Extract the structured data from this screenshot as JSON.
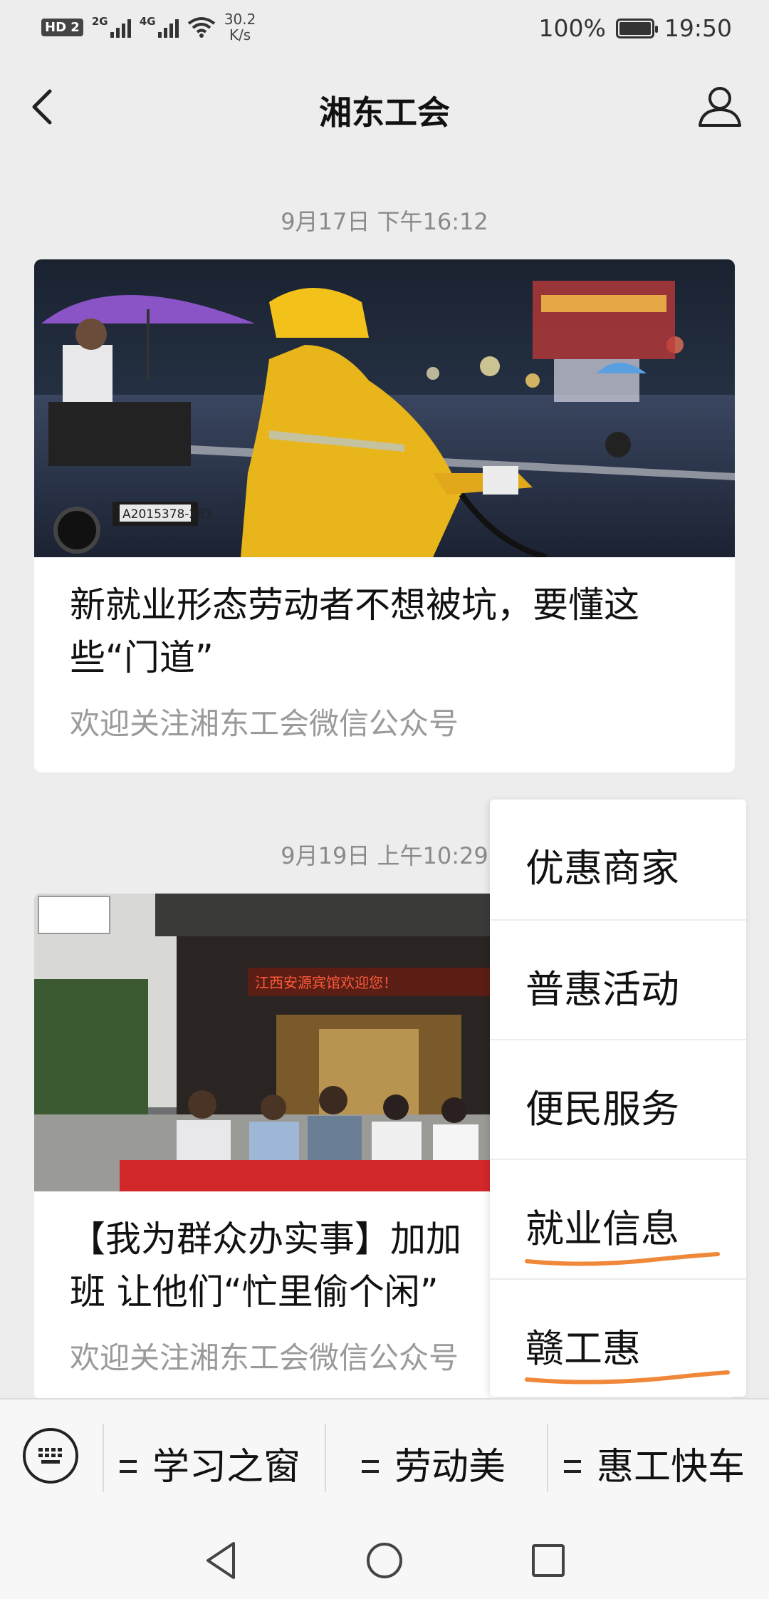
{
  "status_bar": {
    "hd_label": "HD",
    "sim_number": "2",
    "network_a": "2G",
    "network_b": "4G",
    "speed_value": "30.2",
    "speed_unit": "K/s",
    "battery_percent": "100%",
    "battery_level": 1.0,
    "time": "19:50"
  },
  "header": {
    "title": "湘东工会",
    "back_icon": "chevron-left-icon",
    "profile_icon": "person-icon"
  },
  "feed": [
    {
      "timestamp": "9月17日 下午16:12",
      "title": "新就业形态劳动者不想被坑，要懂这些“门道”",
      "subtitle": "欢迎关注湘东工会微信公众号",
      "photo_text": "A2015378-283"
    },
    {
      "timestamp": "9月19日 上午10:29",
      "title": "【我为群众办实事】加加班 让他们“忙里偷个闲”",
      "subtitle": "欢迎关注湘东工会微信公众号",
      "photo_text": "江西安源宾馆欢迎您！"
    }
  ],
  "popup_menu": {
    "items": [
      {
        "label": "优惠商家"
      },
      {
        "label": "普惠活动"
      },
      {
        "label": "便民服务"
      },
      {
        "label": "就业信息"
      },
      {
        "label": "赣工惠"
      }
    ],
    "underline_color": "#f0883a"
  },
  "bottom_menu": {
    "keyboard_icon": "keyboard-icon",
    "items": [
      {
        "label": "学习之窗"
      },
      {
        "label": "劳动美"
      },
      {
        "label": "惠工快车"
      }
    ]
  },
  "colors": {
    "background": "#ededed",
    "timestamp": "#8a8a8a",
    "subtitle": "#9a9a9a"
  }
}
